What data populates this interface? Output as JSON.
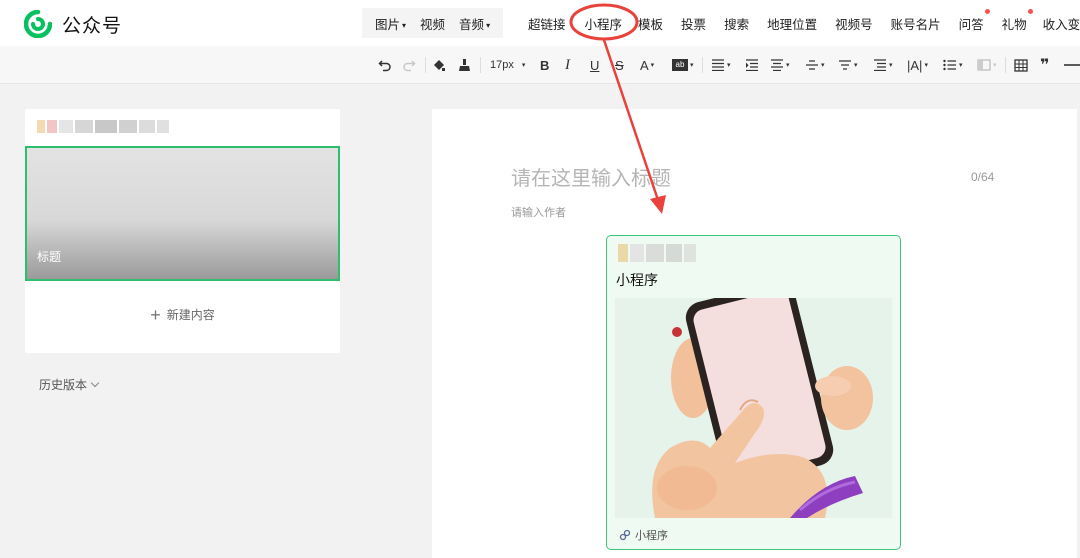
{
  "brand": {
    "name": "公众号",
    "color": "#07c160"
  },
  "nav": {
    "media": [
      {
        "label": "图片",
        "dropdown": true
      },
      {
        "label": "视频",
        "dropdown": false
      },
      {
        "label": "音频",
        "dropdown": true
      }
    ],
    "items": [
      {
        "label": "超链接",
        "dot": false
      },
      {
        "label": "小程序",
        "dot": false
      },
      {
        "label": "模板",
        "dot": false
      },
      {
        "label": "投票",
        "dot": false
      },
      {
        "label": "搜索",
        "dot": false
      },
      {
        "label": "地理位置",
        "dot": false
      },
      {
        "label": "视频号",
        "dot": false
      },
      {
        "label": "账号名片",
        "dot": false
      },
      {
        "label": "问答",
        "dot": true
      },
      {
        "label": "礼物",
        "dot": true
      },
      {
        "label": "收入变",
        "dot": false
      }
    ]
  },
  "toolbar": {
    "font_size": "17px",
    "icons": [
      "undo-icon",
      "redo-icon",
      "format-paint-icon",
      "clear-format-icon",
      "bold-icon",
      "italic-icon",
      "underline-icon",
      "strikethrough-icon",
      "font-color-icon",
      "background-color-icon",
      "align-icon",
      "indent-icon",
      "text-align-icon",
      "line-height-icon",
      "paragraph-spacing-icon",
      "margin-icon",
      "letter-spacing-icon",
      "list-icon",
      "border-icon",
      "table-icon",
      "quote-icon",
      "divider-icon"
    ]
  },
  "left_panel": {
    "cover_title": "标题",
    "new_content": "新建内容",
    "history": "历史版本"
  },
  "editor": {
    "title_placeholder": "请在这里输入标题",
    "title_count": "0/64",
    "author_placeholder": "请输入作者"
  },
  "mini_program_card": {
    "name": "小程序",
    "footer_label": "小程序"
  },
  "colors": {
    "accent_green": "#07c160",
    "card_border": "#3cc878",
    "annotation_red": "#e8423a",
    "notification_dot": "#fa5151"
  }
}
